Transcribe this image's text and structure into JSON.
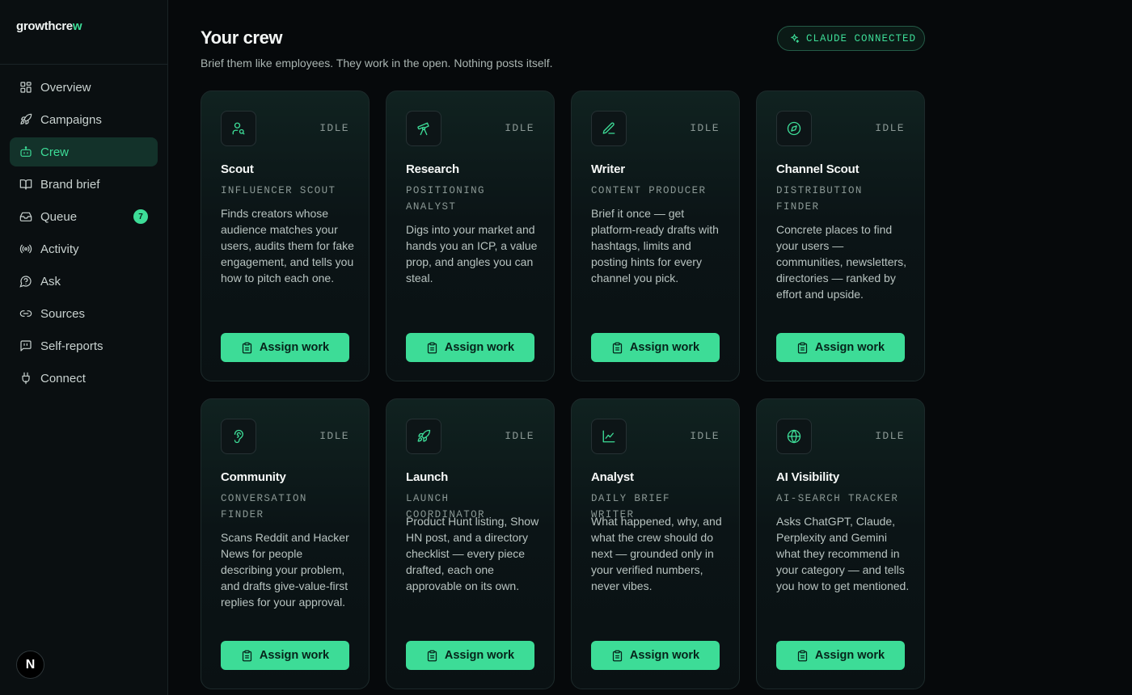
{
  "app": {
    "logo_main": "growthcre",
    "logo_accent": "w"
  },
  "sidebar": {
    "items": [
      {
        "label": "Overview",
        "icon": "grid-icon"
      },
      {
        "label": "Campaigns",
        "icon": "rocket-icon"
      },
      {
        "label": "Crew",
        "icon": "bot-icon",
        "active": true
      },
      {
        "label": "Brand brief",
        "icon": "book-icon"
      },
      {
        "label": "Queue",
        "icon": "inbox-icon",
        "badge": "7"
      },
      {
        "label": "Activity",
        "icon": "broadcast-icon"
      },
      {
        "label": "Ask",
        "icon": "help-circle-icon"
      },
      {
        "label": "Sources",
        "icon": "link-icon"
      },
      {
        "label": "Self-reports",
        "icon": "message-quote-icon"
      },
      {
        "label": "Connect",
        "icon": "plug-icon"
      }
    ],
    "avatar_letter": "N"
  },
  "header": {
    "title": "Your crew",
    "subtitle": "Brief them like employees. They work in the open. Nothing posts itself.",
    "connection_status": "CLAUDE CONNECTED"
  },
  "colors": {
    "accent": "#3ddc97",
    "background": "#06090b",
    "sidebar": "#0a0f11"
  },
  "cards": [
    {
      "name": "Scout",
      "role": "INFLUENCER SCOUT",
      "status": "IDLE",
      "icon": "user-search-icon",
      "desc": "Finds creators whose audience matches your users, audits them for fake engagement, and tells you how to pitch each one.",
      "button": "Assign work"
    },
    {
      "name": "Research",
      "role": "POSITIONING ANALYST",
      "status": "IDLE",
      "icon": "telescope-icon",
      "desc": "Digs into your market and hands you an ICP, a value prop, and angles you can steal.",
      "button": "Assign work"
    },
    {
      "name": "Writer",
      "role": "CONTENT PRODUCER",
      "status": "IDLE",
      "icon": "pen-icon",
      "desc": "Brief it once — get platform-ready drafts with hashtags, limits and posting hints for every channel you pick.",
      "button": "Assign work"
    },
    {
      "name": "Channel Scout",
      "role": "DISTRIBUTION FINDER",
      "status": "IDLE",
      "icon": "compass-icon",
      "desc": "Concrete places to find your users — communities, newsletters, directories — ranked by effort and upside.",
      "button": "Assign work"
    },
    {
      "name": "Community",
      "role": "CONVERSATION FINDER",
      "status": "IDLE",
      "icon": "ear-icon",
      "desc": "Scans Reddit and Hacker News for people describing your problem, and drafts give-value-first replies for your approval.",
      "button": "Assign work"
    },
    {
      "name": "Launch",
      "role": "LAUNCH COORDINATOR",
      "status": "IDLE",
      "icon": "rocket-icon",
      "desc": "Product Hunt listing, Show HN post, and a directory checklist — every piece drafted, each one approvable on its own.",
      "button": "Assign work"
    },
    {
      "name": "Analyst",
      "role": "DAILY BRIEF WRITER",
      "status": "IDLE",
      "icon": "line-chart-icon",
      "desc": "What happened, why, and what the crew should do next — grounded only in your verified numbers, never vibes.",
      "button": "Assign work"
    },
    {
      "name": "AI Visibility",
      "role": "AI-SEARCH TRACKER",
      "status": "IDLE",
      "icon": "globe-icon",
      "desc": "Asks ChatGPT, Claude, Perplexity and Gemini what they recommend in your category — and tells you how to get mentioned.",
      "button": "Assign work"
    }
  ]
}
